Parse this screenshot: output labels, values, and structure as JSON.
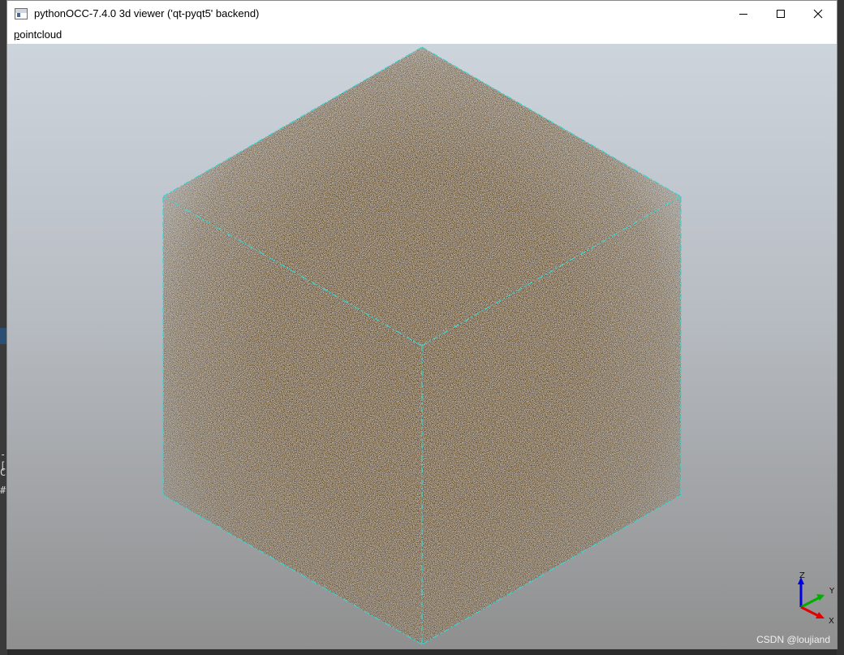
{
  "window": {
    "title": "pythonOCC-7.4.0 3d viewer ('qt-pyqt5' backend)",
    "controls": {
      "minimize": "minimize-icon",
      "maximize": "maximize-icon",
      "close": "close-icon"
    }
  },
  "menubar": {
    "items": [
      {
        "label": "pointcloud",
        "mnemonic": "p"
      }
    ]
  },
  "viewer": {
    "object": "pointcloud",
    "point_color": "#5a3b00",
    "edge_color": "#35d6d6",
    "background_top": "#cdd4dc",
    "background_bottom": "#8f8f8f",
    "triedron": {
      "axes": [
        "X",
        "Y",
        "Z"
      ],
      "x_color": "#e00000",
      "y_color": "#00b000",
      "z_color": "#0000e0"
    }
  },
  "watermark": "CSDN @loujiand",
  "background_console": {
    "lines": [
      "-[",
      "C",
      "#"
    ]
  }
}
